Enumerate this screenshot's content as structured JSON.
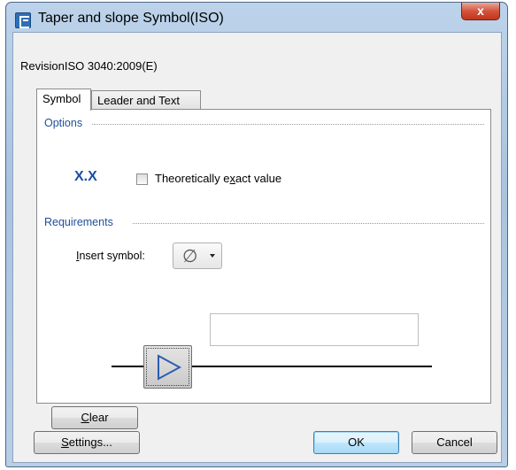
{
  "window": {
    "title": "Taper and slope Symbol(ISO)",
    "close_label": "x"
  },
  "revision": "RevisionISO 3040:2009(E)",
  "tabs": [
    {
      "label": "Symbol",
      "active": true
    },
    {
      "label": "Leader and Text",
      "active": false
    }
  ],
  "options": {
    "group_label": "Options",
    "glyph": "X.X",
    "checkbox": {
      "label_prefix": "Theoretically e",
      "label_mnemonic": "x",
      "label_suffix": "act value",
      "checked": false
    }
  },
  "requirements": {
    "group_label": "Requirements",
    "insert_label_mnemonic": "I",
    "insert_label_rest": "nsert symbol:",
    "selected_symbol": "∅",
    "value": ""
  },
  "buttons": {
    "clear_mnemonic": "C",
    "clear_rest": "lear",
    "settings_mnemonic": "S",
    "settings_rest": "ettings...",
    "ok": "OK",
    "cancel": "Cancel"
  },
  "colors": {
    "group_label": "#1f4f9a",
    "glyph": "#1c4ea8",
    "taper_icon": "#2a5db0"
  },
  "icons": {
    "app": "app-icon",
    "close": "close-icon",
    "taper": "taper-triangle-icon",
    "dropdown": "chevron-down-icon"
  }
}
